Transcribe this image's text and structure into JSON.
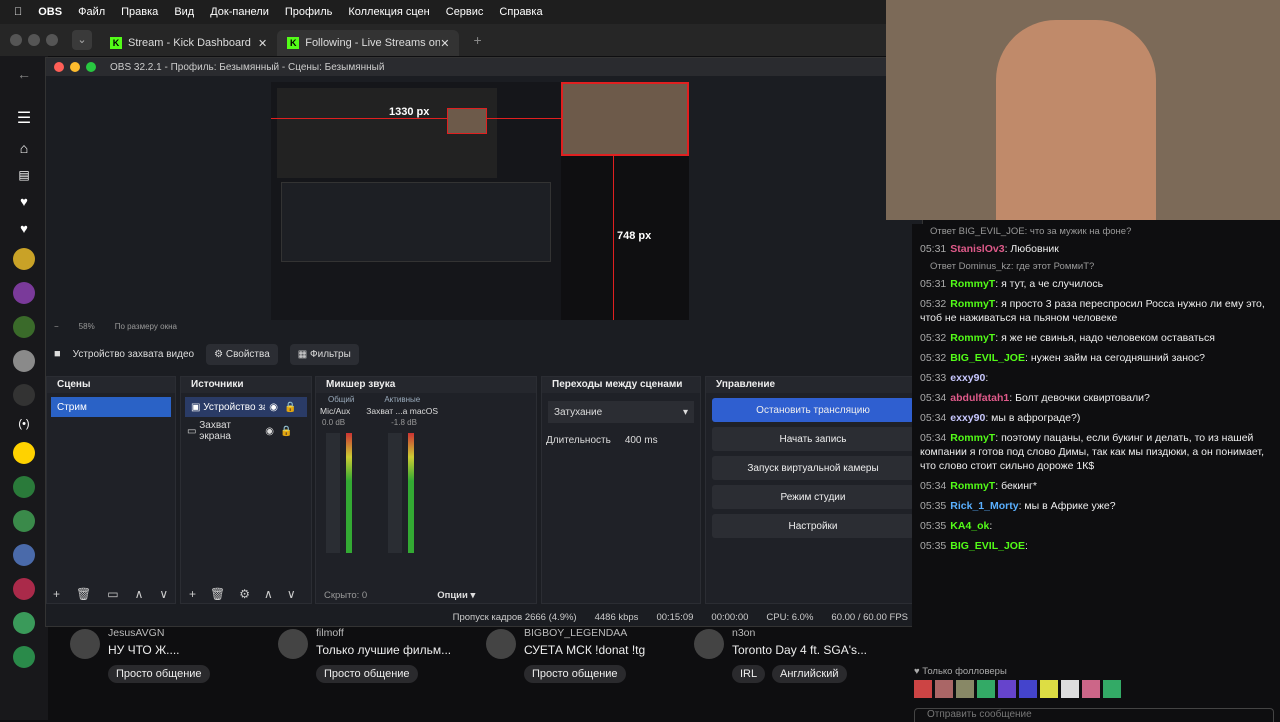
{
  "menubar": {
    "app": "OBS",
    "items": [
      "Файл",
      "Правка",
      "Вид",
      "Док-панели",
      "Профиль",
      "Коллекция сцен",
      "Сервис",
      "Справка"
    ]
  },
  "tabs": [
    {
      "label": "Stream - Kick Dashboard"
    },
    {
      "label": "Following - Live Streams on K"
    }
  ],
  "obs": {
    "title": "OBS 32.2.1 - Профиль: Безымянный - Сцены: Безымянный",
    "preview": {
      "width_label": "1330 px",
      "height_label": "748 px",
      "zoom": "58%",
      "fit": "По размеру окна"
    },
    "source_bar": {
      "device": "Устройство захвата видео",
      "props": "Свойства",
      "filters": "Фильтры"
    },
    "scenes": {
      "title": "Сцены",
      "items": [
        "Стрим"
      ]
    },
    "sources": {
      "title": "Источники",
      "items": [
        "Устройство зах",
        "Захват экрана"
      ]
    },
    "mixer": {
      "title": "Микшер звука",
      "tab1": "Общий",
      "tab2": "Активные",
      "ch1": {
        "name": "Mic/Aux",
        "db": "0.0 dB"
      },
      "ch2": {
        "name": "Захват ...a macOS",
        "db": "-1.8 dB"
      },
      "hidden": "Скрыто: 0",
      "options": "Опции"
    },
    "transitions": {
      "title": "Переходы между сценами",
      "type": "Затухание",
      "dur_label": "Длительность",
      "dur_value": "400 ms"
    },
    "controls": {
      "title": "Управление",
      "stop": "Остановить трансляцию",
      "record": "Начать запись",
      "vcam": "Запуск виртуальной камеры",
      "studio": "Режим студии",
      "settings": "Настройки"
    },
    "status": {
      "dropped": "Пропуск кадров 2666 (4.9%)",
      "bitrate": "4486 kbps",
      "stream_time": "00:15:09",
      "rec_time": "00:00:00",
      "cpu": "CPU: 6.0%",
      "fps": "60.00 / 60.00 FPS"
    }
  },
  "chat": {
    "messages": [
      {
        "type": "reply",
        "text": "Ответ BIG_EVIL_JOE: что за мужик на фоне?"
      },
      {
        "time": "05:31",
        "user": "StanislOv3",
        "color": "#e05a8a",
        "text": "Любовник"
      },
      {
        "type": "reply",
        "text": "Ответ Dominus_kz: где этот РоммиТ?"
      },
      {
        "time": "05:31",
        "user": "RommyT",
        "color": "#53fc18",
        "text": "я тут, а че случилось"
      },
      {
        "time": "05:32",
        "user": "RommyT",
        "color": "#53fc18",
        "text": "я просто 3 раза переспросил Росса нужно ли ему это, чтоб не наживаться на пьяном человеке"
      },
      {
        "time": "05:32",
        "user": "RommyT",
        "color": "#53fc18",
        "text": "я же не свинья, надо человеком оставаться"
      },
      {
        "time": "05:32",
        "user": "BIG_EVIL_JOE",
        "color": "#53fc18",
        "text": "нужен займ на сегодняшний занос?"
      },
      {
        "time": "05:33",
        "user": "exxy90",
        "color": "#c8c8ff",
        "text": ""
      },
      {
        "time": "05:34",
        "user": "abdulfatah1",
        "color": "#e05a8a",
        "text": "Болт девочки сквиртовали?"
      },
      {
        "time": "05:34",
        "user": "exxy90",
        "color": "#c8c8ff",
        "text": "мы в афрограде?)"
      },
      {
        "time": "05:34",
        "user": "RommyT",
        "color": "#53fc18",
        "text": "поэтому пацаны, если букинг и делать, то из нашей компании я готов под слово Димы, так как мы пиздюки, а он понимает, что слово стоит сильно дороже 1К$"
      },
      {
        "time": "05:34",
        "user": "RommyT",
        "color": "#53fc18",
        "text": "бекинг*"
      },
      {
        "time": "05:35",
        "user": "Rick_1_Morty",
        "color": "#5ab0ff",
        "text": "мы в Африке уже?"
      },
      {
        "time": "05:35",
        "user": "KA4_ok",
        "color": "#53fc18",
        "text": ""
      },
      {
        "time": "05:35",
        "user": "BIG_EVIL_JOE",
        "color": "#53fc18",
        "text": ""
      }
    ],
    "followers_only": "Только фолловеры",
    "input_placeholder": "Отправить сообщение"
  },
  "following": [
    {
      "name": "JesusAVGN",
      "title": "НУ ЧТО Ж....",
      "tags": [
        "Просто общение"
      ]
    },
    {
      "name": "filmoff",
      "title": "Только лучшие фильм...",
      "tags": [
        "Просто общение"
      ]
    },
    {
      "name": "BIGBOY_LEGENDAA",
      "title": "СУЕТА МСК !donat !tg",
      "tags": [
        "Просто общение"
      ]
    },
    {
      "name": "n3on",
      "title": "Toronto Day 4 ft. SGA's...",
      "tags": [
        "IRL",
        "Английский"
      ]
    }
  ]
}
